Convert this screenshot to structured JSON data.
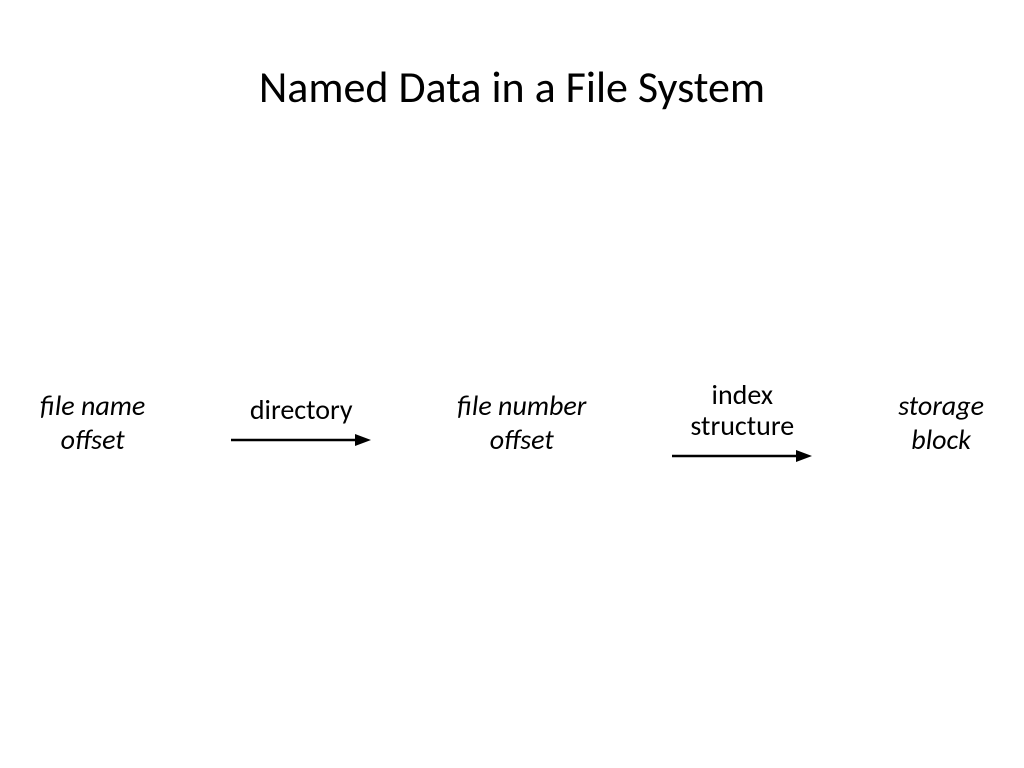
{
  "title": "Named Data in a File System",
  "nodes": {
    "n1_line1": "file name",
    "n1_line2": "offset",
    "n2_line1": "file number",
    "n2_line2": "offset",
    "n3_line1": "storage",
    "n3_line2": "block"
  },
  "arrows": {
    "a1_label": "directory",
    "a2_label_line1": "index",
    "a2_label_line2": "structure"
  }
}
